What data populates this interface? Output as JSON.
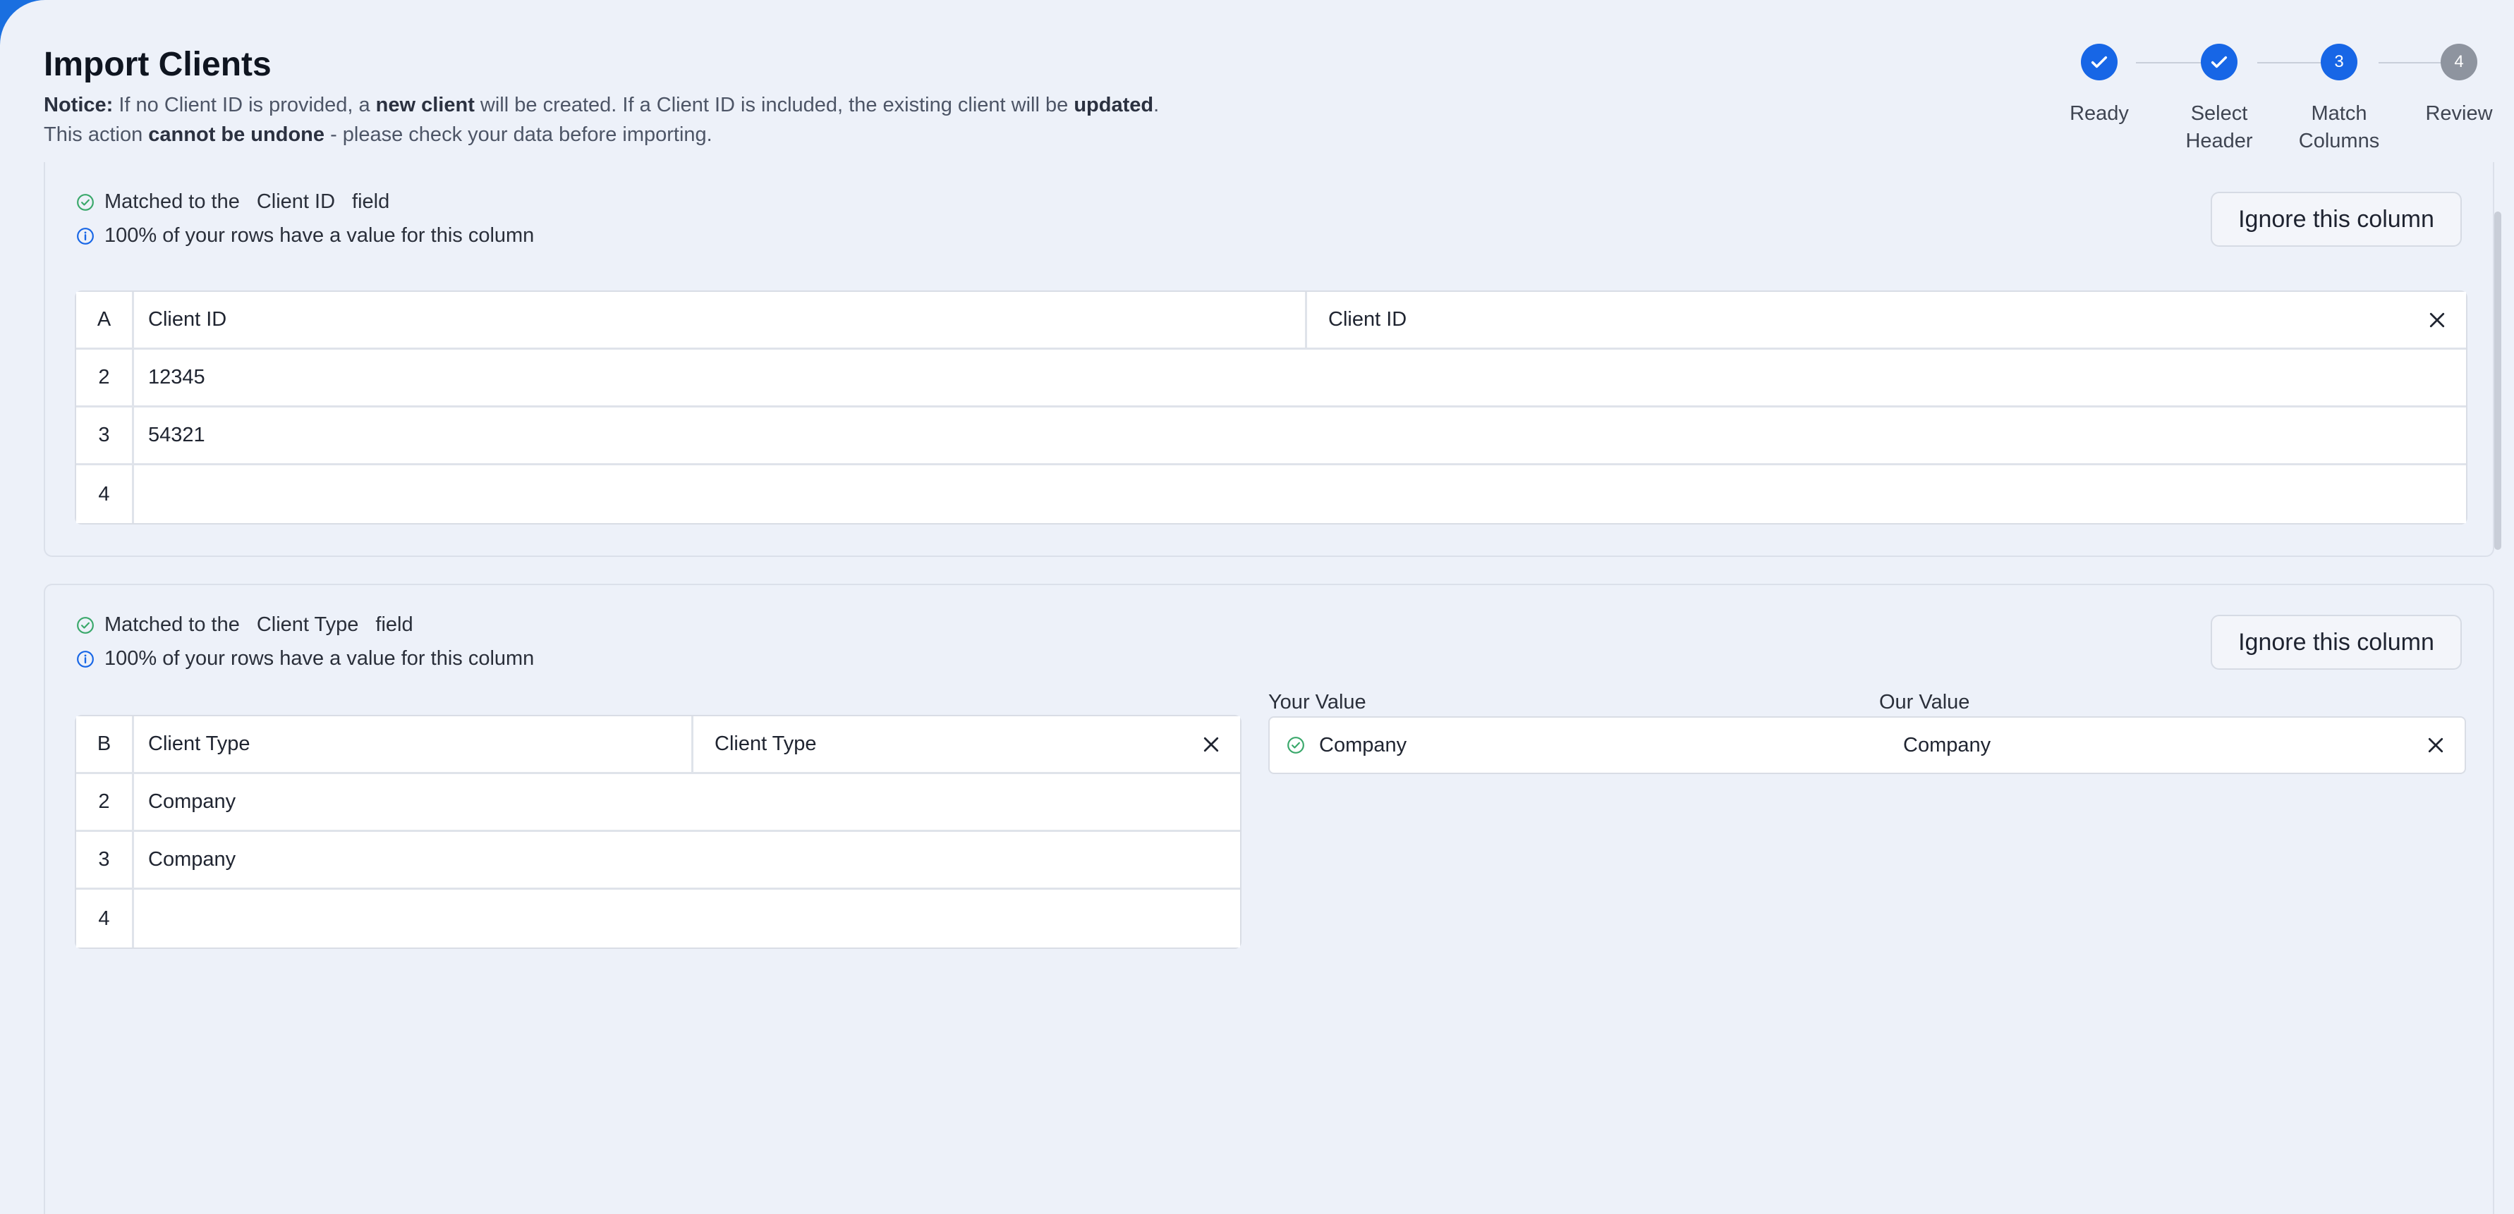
{
  "page": {
    "title": "Import Clients",
    "notice": {
      "label": "Notice:",
      "t1": "If no Client ID is provided, a",
      "b1": "new client",
      "t2": "will be created. If a Client ID is included, the existing client will be",
      "b2": "updated",
      "t3": ".",
      "t4": "This action",
      "b3": "cannot be undone",
      "t5": "- please check your data before importing."
    }
  },
  "stepper": {
    "steps": [
      {
        "label": "Ready",
        "state": "done"
      },
      {
        "label": "Select Header",
        "state": "done"
      },
      {
        "label": "Match Columns",
        "number": "3",
        "state": "active"
      },
      {
        "label": "Review",
        "number": "4",
        "state": "todo"
      }
    ]
  },
  "columns": [
    {
      "matched_prefix": "Matched to the",
      "field": "Client ID",
      "matched_suffix": "field",
      "coverage": "100% of your rows have a value for this column",
      "ignore_label": "Ignore this column",
      "letter": "A",
      "header": "Client ID",
      "target": "Client ID",
      "rows": [
        {
          "num": "2",
          "value": "12345"
        },
        {
          "num": "3",
          "value": "54321"
        },
        {
          "num": "4",
          "value": ""
        }
      ]
    },
    {
      "matched_prefix": "Matched to the",
      "field": "Client Type",
      "matched_suffix": "field",
      "coverage": "100% of your rows have a value for this column",
      "ignore_label": "Ignore this column",
      "letter": "B",
      "header": "Client Type",
      "target": "Client Type",
      "rows": [
        {
          "num": "2",
          "value": "Company"
        },
        {
          "num": "3",
          "value": "Company"
        },
        {
          "num": "4",
          "value": ""
        }
      ],
      "value_map": {
        "your_value_label": "Your Value",
        "our_value_label": "Our Value",
        "your_value": "Company",
        "our_value": "Company"
      }
    }
  ],
  "colors": {
    "accent": "#1766e6",
    "success": "#3aa86b",
    "info": "#1766e6",
    "background": "#edf1f9"
  }
}
